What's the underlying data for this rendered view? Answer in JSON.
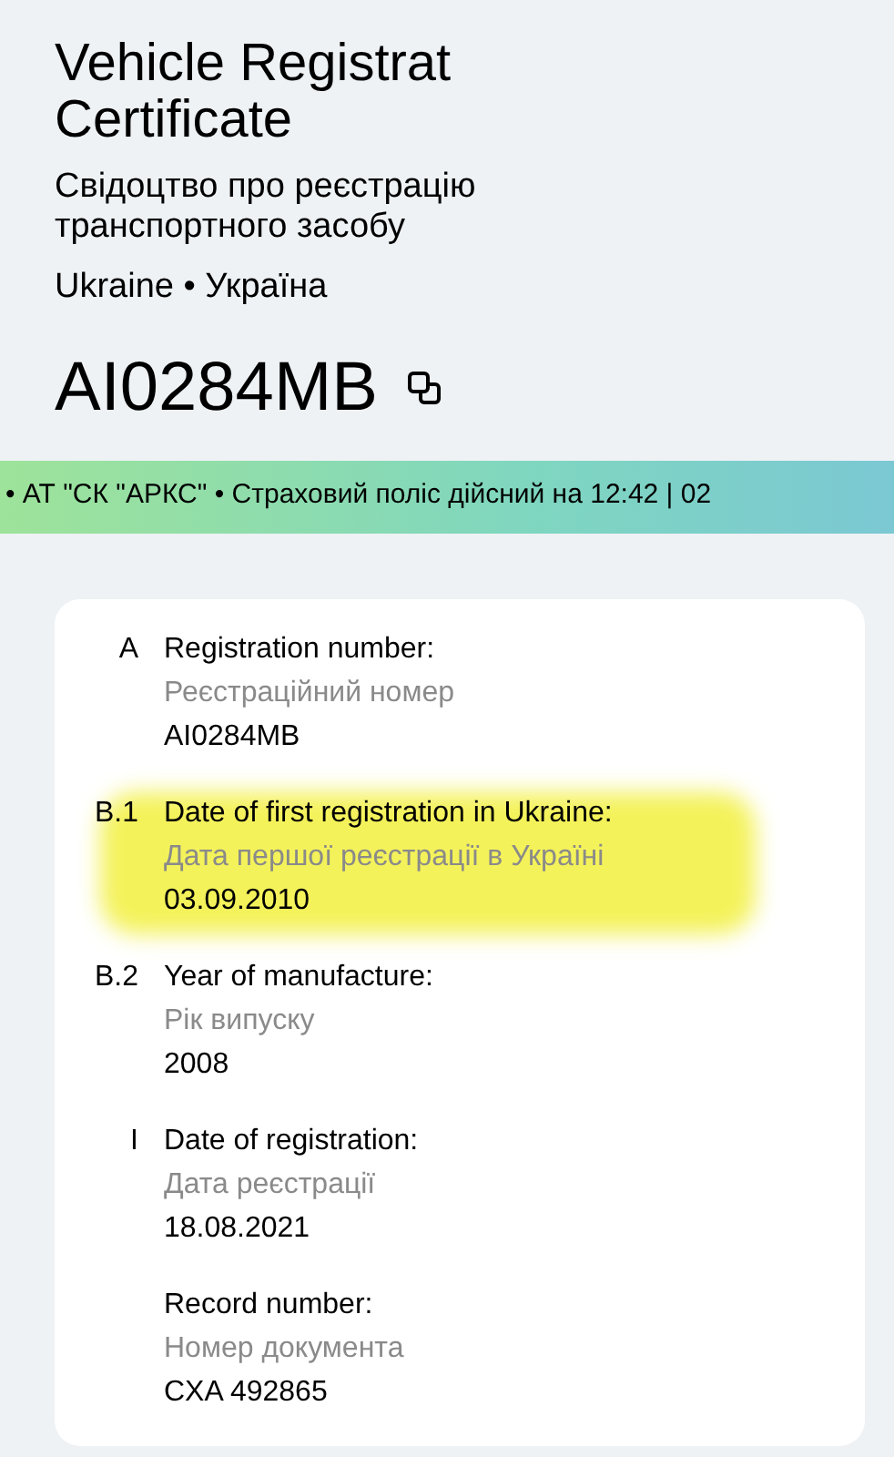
{
  "title_lines": [
    "Vehicle Registrat",
    "Certificate"
  ],
  "subtitle": "Свідоцтво про реєстрацію транспортного засобу",
  "country": "Ukraine • Україна",
  "plate": "AI0284MB",
  "ticker": "• АТ \"СК \"АРКС\" • Страховий поліс дійсний на 12:42 | 02",
  "fields": [
    {
      "code": "A",
      "label": "Registration number:",
      "label_uk": "Реєстраційний номер",
      "value": "AI0284MB",
      "highlighted": false
    },
    {
      "code": "B.1",
      "label": "Date of first registration in Ukraine:",
      "label_uk": "Дата першої реєстрації в Україні",
      "value": "03.09.2010",
      "highlighted": true
    },
    {
      "code": "B.2",
      "label": "Year of manufacture:",
      "label_uk": "Рік випуску",
      "value": "2008",
      "highlighted": false
    },
    {
      "code": "I",
      "label": "Date of registration:",
      "label_uk": "Дата реєстрації",
      "value": "18.08.2021",
      "highlighted": false
    },
    {
      "label": "Record number:",
      "label_uk": "Номер документа",
      "value": "CXA 492865",
      "highlighted": false
    }
  ]
}
